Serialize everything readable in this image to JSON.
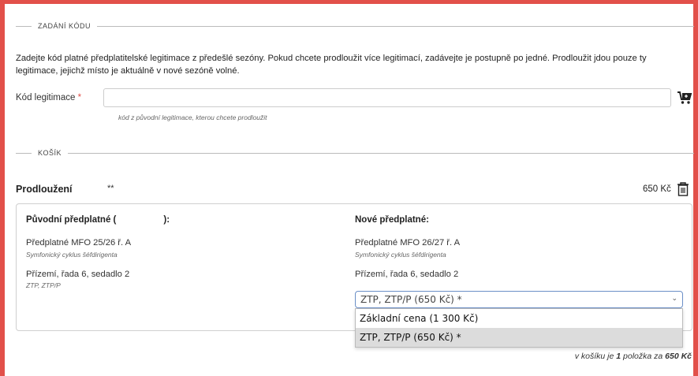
{
  "sections": {
    "code_entry_title": "ZADÁNÍ KÓDU",
    "cart_title": "KOŠÍK"
  },
  "intro_text": "Zadejte kód platné předplatitelské legitimace z předešlé sezóny. Pokud chcete prodloužit více legitimací, zadávejte je postupně po jedné. Prodloužit jdou pouze ty legitimace, jejichž místo je aktuálně v nové sezóně volné.",
  "code_field": {
    "label": "Kód legitimace",
    "required_mark": "*",
    "value": "",
    "hint": "kód z původní legitimace, kterou chcete prodloužit"
  },
  "extension": {
    "title": "Prodloužení",
    "code_mask": "**",
    "price": "650 Kč"
  },
  "original": {
    "heading_prefix": "Původní předplatné (",
    "heading_suffix": "):",
    "subscription": "Předplatné MFO 25/26 ř. A",
    "cycle": "Symfonický cyklus šéfdirigenta",
    "seat": "Přízemí, řada 6, sedadlo 2",
    "discount": "ZTP, ZTP/P"
  },
  "new": {
    "heading": "Nové předplatné:",
    "subscription": "Předplatné MFO 26/27 ř. A",
    "cycle": "Symfonický cyklus šéfdirigenta",
    "seat": "Přízemí, řada 6, sedadlo 2",
    "select_value": "ZTP, ZTP/P (650 Kč) *",
    "options": [
      "Základní cena (1 300 Kč)",
      "ZTP, ZTP/P (650 Kč) *"
    ]
  },
  "summary": {
    "prefix": "v košíku je ",
    "count": "1",
    "middle": " položka za ",
    "total": "650 Kč"
  },
  "icons": {
    "cart": "cart-add-icon",
    "trash": "trash-icon",
    "chevron": "chevron-down-icon"
  },
  "colors": {
    "frame": "#e2504a",
    "required": "#e2504a",
    "select_border": "#6b8fc7"
  }
}
